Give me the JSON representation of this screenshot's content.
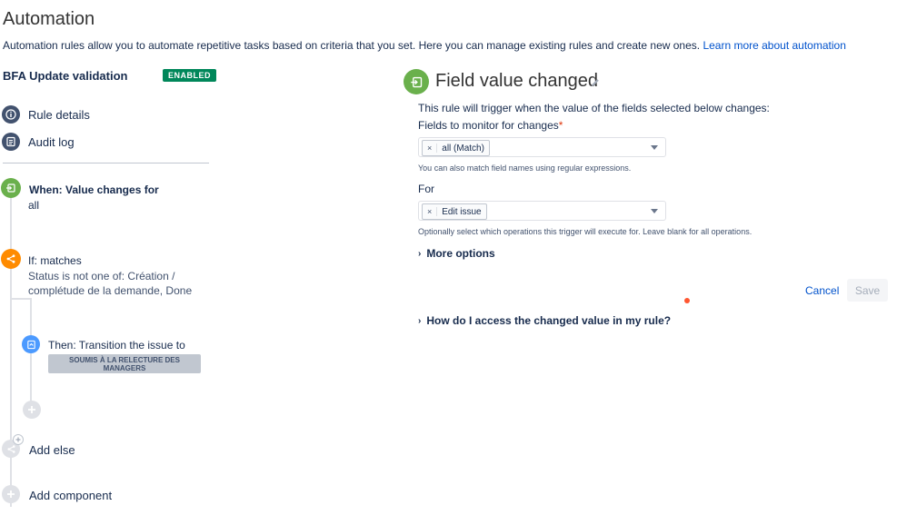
{
  "page": {
    "title": "Automation",
    "description": "Automation rules allow you to automate repetitive tasks based on criteria that you set. Here you can manage existing rules and create new ones.",
    "learn_more": "Learn more about automation"
  },
  "rule": {
    "name": "BFA Update validation",
    "status": "ENABLED"
  },
  "nav": {
    "rule_details": "Rule details",
    "audit_log": "Audit log"
  },
  "components": {
    "trigger_title": "When: Value changes for",
    "trigger_value": "all",
    "condition_title": "If: matches",
    "condition_line1": "Status is not one of: Création /",
    "condition_line2": "complétude de la demande, Done",
    "action_title": "Then: Transition the issue to",
    "action_status_line1": "SOUMIS À LA RELECTURE DES",
    "action_status_line2": "MANAGERS",
    "add_else": "Add else",
    "add_component": "Add component"
  },
  "panel": {
    "title": "Field value changed",
    "intro": "This rule will trigger when the value of the fields selected below changes:",
    "fields_label": "Fields to monitor for changes",
    "required_mark": "*",
    "fields_tag": "all (Match)",
    "fields_help": "You can also match field names using regular expressions.",
    "for_label": "For",
    "for_tag": "Edit issue",
    "for_help": "Optionally select which operations this trigger will execute for. Leave blank for all operations.",
    "more_options": "More options",
    "cancel": "Cancel",
    "save": "Save",
    "how_access": "How do I access the changed value in my rule?",
    "tag_remove": "×"
  },
  "colors": {
    "enabled_badge": "#00875a",
    "trigger": "#6ab04c",
    "condition": "#ff8b00",
    "action": "#4c9aff",
    "link": "#0052cc"
  }
}
